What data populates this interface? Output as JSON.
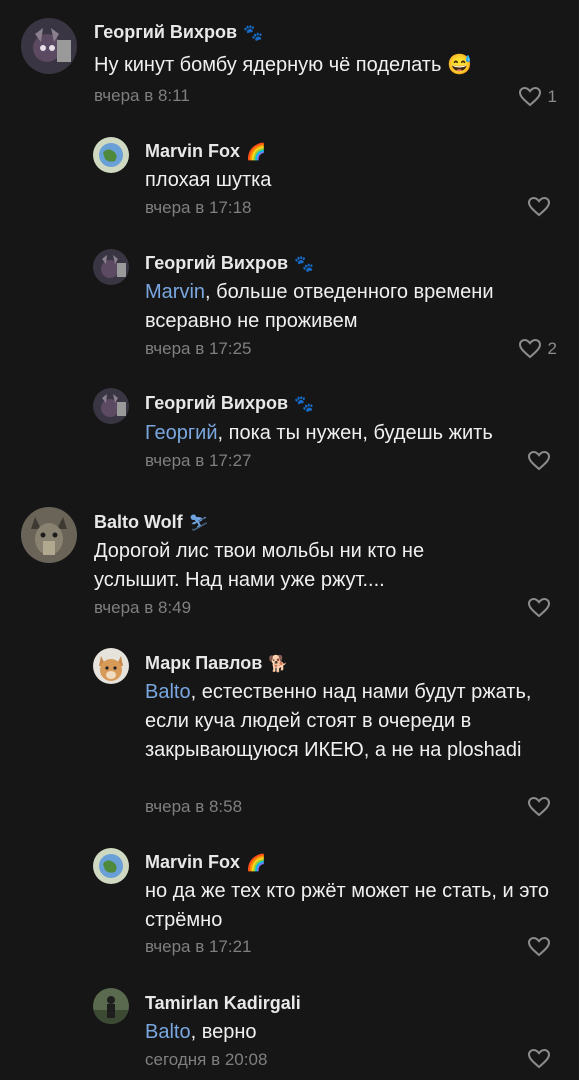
{
  "comments": [
    {
      "author": "Георгий Вихров",
      "badge": "🐾",
      "text": "Ну кинут бомбу ядерную чё поделать",
      "emoji": "😅",
      "time": "вчера в 8:11",
      "likes": "1"
    },
    {
      "author": "Marvin Fox",
      "badge": "🌈",
      "text": "плохая шутка",
      "time": "вчера в 17:18",
      "likes": ""
    },
    {
      "author": "Георгий Вихров",
      "badge": "🐾",
      "mention": "Marvin",
      "text": ", больше  отведенного времени всеравно не проживем",
      "time": "вчера в 17:25",
      "likes": "2"
    },
    {
      "author": "Георгий Вихров",
      "badge": "🐾",
      "mention": "Георгий",
      "text": ", пока ты нужен, будешь жить",
      "time": "вчера в 17:27",
      "likes": ""
    },
    {
      "author": "Balto Wolf",
      "badge": "⛷",
      "text": "Дорогой лис твои мольбы ни кто не услышит. Над нами уже ржут....",
      "time": "вчера в 8:49",
      "likes": ""
    },
    {
      "author": "Марк Павлов",
      "badge": "🐕",
      "mention": "Balto",
      "text": ", естественно над нами будут ржать, если куча людей стоят в очереди в закрывающуюся ИКЕЮ, а не на ploshadi",
      "time": "вчера в 8:58",
      "likes": ""
    },
    {
      "author": "Marvin Fox",
      "badge": "🌈",
      "text": "но да же тех кто ржёт может не стать, и это стрёмно",
      "time": "вчера в 17:21",
      "likes": ""
    },
    {
      "author": "Tamirlan Kadirgali",
      "mention": "Balto",
      "text": ", верно",
      "time": "сегодня в 20:08",
      "likes": ""
    }
  ],
  "icons": {
    "like": "heart-outline-icon"
  },
  "colors": {
    "background": "#161616",
    "mention": "#7aa7e0",
    "meta": "#7f7f7f"
  }
}
